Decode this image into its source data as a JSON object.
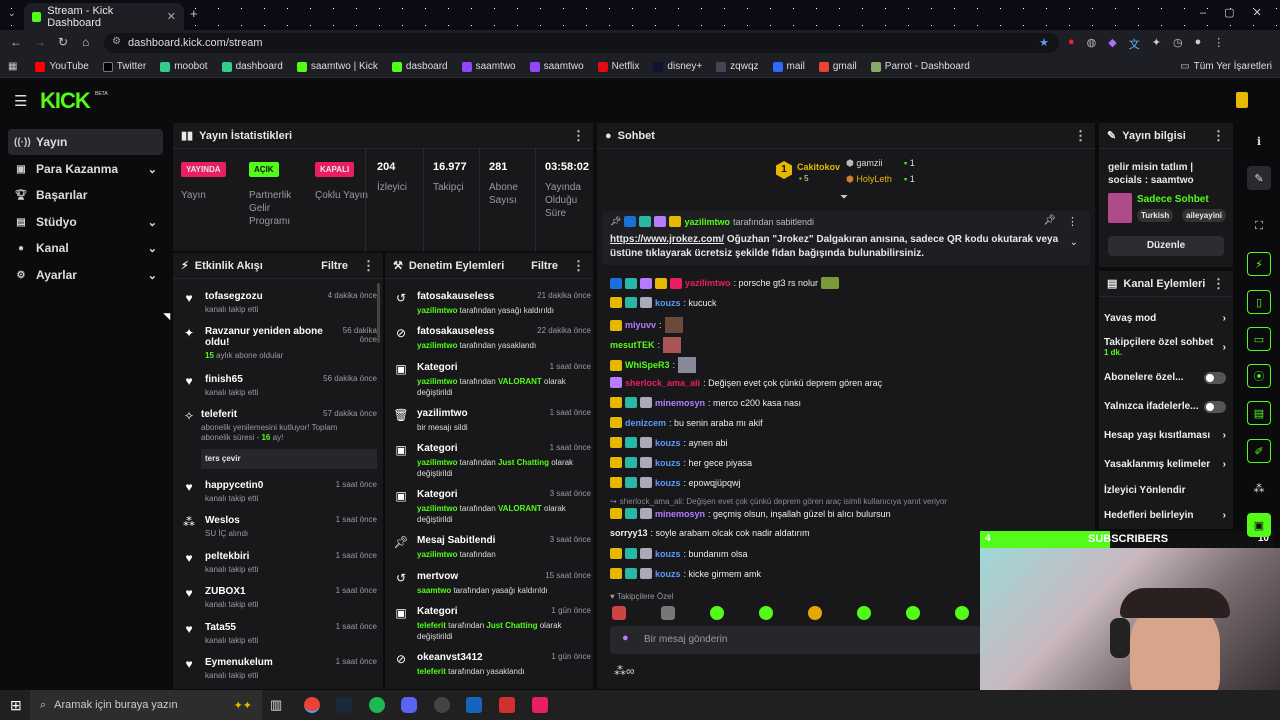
{
  "browser": {
    "tab_title": "Stream - Kick Dashboard",
    "url": "dashboard.kick.com/stream",
    "bookmarks": [
      "YouTube",
      "Twitter",
      "moobot",
      "dashboard",
      "saamtwo | Kick",
      "dasboard",
      "saamtwo",
      "saamtwo",
      "Netflix",
      "disney+",
      "zqwqz",
      "mail",
      "gmail",
      "Parrot - Dashboard"
    ],
    "bookmarks_other": "Tüm Yer İşaretleri"
  },
  "app": {
    "logo": "KICK",
    "logo_sup": "BETA"
  },
  "nav": {
    "items": [
      {
        "label": "Yayın",
        "icon": "broadcast-icon"
      },
      {
        "label": "Para Kazanma",
        "icon": "money-icon"
      },
      {
        "label": "Başarılar",
        "icon": "trophy-icon"
      },
      {
        "label": "Stüdyo",
        "icon": "studio-icon"
      },
      {
        "label": "Kanal",
        "icon": "user-icon"
      },
      {
        "label": "Ayarlar",
        "icon": "gear-icon"
      }
    ]
  },
  "stats": {
    "title": "Yayın İstatistikleri",
    "badges": [
      {
        "badge": "YAYINDA",
        "label": "Yayın",
        "color": "#e91e63"
      },
      {
        "badge": "AÇIK",
        "label": "Partnerlik Gelir Programı",
        "color": "#53fc18"
      },
      {
        "badge": "KAPALI",
        "label": "Çoklu Yayın",
        "color": "#e91e63"
      }
    ],
    "numbers": [
      {
        "value": "204",
        "label": "İzleyici"
      },
      {
        "value": "16.977",
        "label": "Takipçi"
      },
      {
        "value": "281",
        "label": "Abone Sayısı"
      },
      {
        "value": "03:58:02",
        "label": "Yayında Olduğu Süre"
      }
    ]
  },
  "activity": {
    "title": "Etkinlik Akışı",
    "filter": "Filtre",
    "items": [
      {
        "name": "tofasegzozu",
        "sub": "kanalı takip etti",
        "time": "4 dakika önce"
      },
      {
        "name": "Ravzanur yeniden abone oldu!",
        "sub_pre": "15",
        "sub": " aylık abone oldular",
        "time": "56 dakika önce"
      },
      {
        "name": "finish65",
        "sub": "kanalı takip etti",
        "time": "56 dakika önce"
      },
      {
        "name": "teleferit",
        "sub": "abonelik yenilemesini kutluyor! Toplam abonelik süresi - ",
        "sub_num": "16",
        "sub_end": " ay!",
        "time": "57 dakika önce",
        "reply": "ters çevir"
      },
      {
        "name": "happycetin0",
        "sub": "kanalı takip etti",
        "time": "1 saat önce"
      },
      {
        "name": "Weslos",
        "sub": "SU İÇ alındı",
        "time": "1 saat önce"
      },
      {
        "name": "peltekbiri",
        "sub": "kanalı takip etti",
        "time": "1 saat önce"
      },
      {
        "name": "ZUBOX1",
        "sub": "kanalı takip etti",
        "time": "1 saat önce"
      },
      {
        "name": "Tata55",
        "sub": "kanalı takip etti",
        "time": "1 saat önce"
      },
      {
        "name": "Eymenukelum",
        "sub": "kanalı takip etti",
        "time": "1 saat önce"
      }
    ]
  },
  "moderation": {
    "title": "Denetim Eylemleri",
    "filter": "Filtre",
    "items": [
      {
        "name": "fatosakauseless",
        "who": "yazilimtwo",
        "desc": " tarafından yasağı kaldırıldı",
        "time": "21 dakika önce"
      },
      {
        "name": "fatosakauseless",
        "who": "yazilimtwo",
        "desc": " tarafından yasaklandı",
        "time": "22 dakika önce"
      },
      {
        "name": "Kategori",
        "who": "yazilimtwo",
        "desc": " tarafından ",
        "cat": "VALORANT",
        "desc2": " olarak değiştirildi",
        "time": "1 saat önce"
      },
      {
        "name": "yazilimtwo",
        "who": "",
        "desc": "bir mesajı sildi",
        "time": "1 saat önce"
      },
      {
        "name": "Kategori",
        "who": "yazilimtwo",
        "desc": " tarafından ",
        "cat": "Just Chatting",
        "desc2": " olarak değiştirildi",
        "time": "1 saat önce"
      },
      {
        "name": "Kategori",
        "who": "yazilimtwo",
        "desc": " tarafından ",
        "cat": "VALORANT",
        "desc2": " olarak değiştirildi",
        "time": "3 saat önce"
      },
      {
        "name": "Mesaj Sabitlendi",
        "who": "yazilimtwo",
        "desc": " tarafından",
        "time": "3 saat önce"
      },
      {
        "name": "mertvow",
        "who": "saamtwo",
        "desc": " tarafından yasağı kaldırıldı",
        "time": "15 saat önce"
      },
      {
        "name": "Kategori",
        "who": "teleferit",
        "desc": " tarafından ",
        "cat": "Just Chatting",
        "desc2": " olarak değiştirildi",
        "time": "1 gün önce"
      },
      {
        "name": "okeanvst3412",
        "who": "teleferit",
        "desc": " tarafından yasaklandı",
        "time": "1 gün önce"
      }
    ]
  },
  "chat": {
    "title": "Sohbet",
    "top": [
      {
        "rank": "1",
        "name": "Cakitokov",
        "count": "5"
      },
      {
        "name": "gamzii",
        "count": "1"
      },
      {
        "name": "HolyLeth",
        "count": "1"
      }
    ],
    "pinned": {
      "by": "yazilimtwo",
      "by_text": " tarafından sabitlendi",
      "link": "https://www.jrokez.com/",
      "text": " Oğuzhan \"Jrokez\" Dalgakıran anısına, sadece QR kodu okutarak veya üstüne tıklayarak ücretsiz şekilde fidan bağışında bulunabilirsiniz."
    },
    "messages": [
      {
        "user": "yazilimtwo",
        "color": "#e91e63",
        "text": ": porsche gt3 rs nolur"
      },
      {
        "user": "kouzs",
        "color": "#5a9cff",
        "text": ": kucuck"
      },
      {
        "user": "miyuvv",
        "color": "#b57cff",
        "text": ":"
      },
      {
        "user": "mesutTEK",
        "color": "#53fc18",
        "text": ":"
      },
      {
        "user": "WhiSpeR3",
        "color": "#53fc18",
        "text": ":"
      },
      {
        "user": "sherlock_ama_ali",
        "color": "#e91e63",
        "text": ": Değişen evet çok çünkü deprem gören araç"
      },
      {
        "user": "minemosyn",
        "color": "#b57cff",
        "text": ": merco c200 kasa nası"
      },
      {
        "user": "denizcem",
        "color": "#5a9cff",
        "text": ": bu senin araba mı akif"
      },
      {
        "user": "kouzs",
        "color": "#5a9cff",
        "text": ": aynen abi"
      },
      {
        "user": "kouzs",
        "color": "#5a9cff",
        "text": ": her gece piyasa"
      },
      {
        "user": "kouzs",
        "color": "#5a9cff",
        "text": ": epowqjüpqwj"
      },
      {
        "reply": "sherlock_ama_ali: Değişen evet çok çünkü deprem gören araç isimli kullanıcıya yanıt veriyor"
      },
      {
        "user": "minemosyn",
        "color": "#b57cff",
        "text": ": geçmiş olsun, inşallah güzel bi alıcı bulursun"
      },
      {
        "user": "sorryy13",
        "color": "#eeeeee",
        "text": ": soyle arabam olcak cok nadir aldatırım"
      },
      {
        "user": "kouzs",
        "color": "#5a9cff",
        "text": ": bundanım olsa"
      },
      {
        "user": "kouzs",
        "color": "#5a9cff",
        "text": ": kicke girmem amk"
      }
    ],
    "followers_only": "Takipçilere Özel",
    "input_placeholder": "Bir mesaj gönderin"
  },
  "stream_info": {
    "title": "Yayın bilgisi",
    "stream_title": "gelir misin tatlım | socials : saamtwo",
    "category": "Sadece Sohbet",
    "tags": [
      "Turkish",
      "aileyayini"
    ],
    "edit": "Düzenle"
  },
  "channel_actions": {
    "title": "Kanal Eylemleri",
    "items": [
      {
        "label": "Yavaş mod",
        "type": "chevron"
      },
      {
        "label": "Takipçilere özel sohbet",
        "sub": "1 dk.",
        "type": "chevron"
      },
      {
        "label": "Abonelere özel...",
        "type": "toggle"
      },
      {
        "label": "Yalnızca ifadelerle...",
        "type": "toggle"
      },
      {
        "label": "Hesap yaşı kısıtlaması",
        "type": "chevron"
      },
      {
        "label": "Yasaklanmış kelimeler",
        "type": "chevron"
      },
      {
        "label": "İzleyici Yönlendir",
        "type": "none"
      },
      {
        "label": "Hedefleri belirleyin",
        "type": "chevron"
      }
    ]
  },
  "overlay": {
    "left": "4",
    "title": "SUBSCRIBERS",
    "right": "10"
  },
  "taskbar": {
    "search": "Aramak için buraya yazın"
  }
}
